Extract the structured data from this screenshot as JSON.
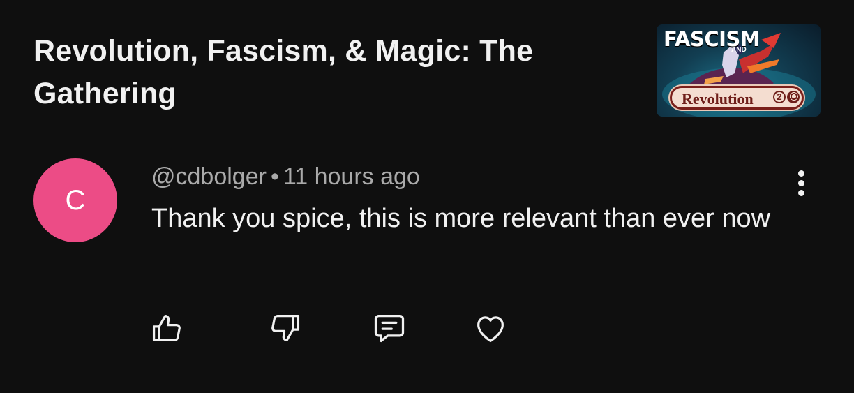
{
  "video": {
    "title": "Revolution, Fascism, & Magic: The Gathering",
    "thumbnail": {
      "headline": "FASCISM",
      "and_label": "AND",
      "badge_label": "Revolution",
      "badge_number": "2"
    }
  },
  "comment": {
    "avatar_letter": "C",
    "avatar_color": "#ec4c86",
    "author": "@cdbolger",
    "separator": "•",
    "timestamp": "11 hours ago",
    "text": "Thank you spice, this is more relevant than ever now"
  },
  "actions": [
    {
      "name": "like",
      "icon": "thumbs-up-icon"
    },
    {
      "name": "dislike",
      "icon": "thumbs-down-icon"
    },
    {
      "name": "reply",
      "icon": "comment-icon"
    },
    {
      "name": "heart",
      "icon": "heart-icon"
    }
  ],
  "menu": {
    "icon": "more-vertical-icon"
  },
  "colors": {
    "background": "#0f0f0f",
    "primary_text": "#f1f1f1",
    "secondary_text": "#aaaaaa",
    "avatar": "#ec4c86"
  }
}
